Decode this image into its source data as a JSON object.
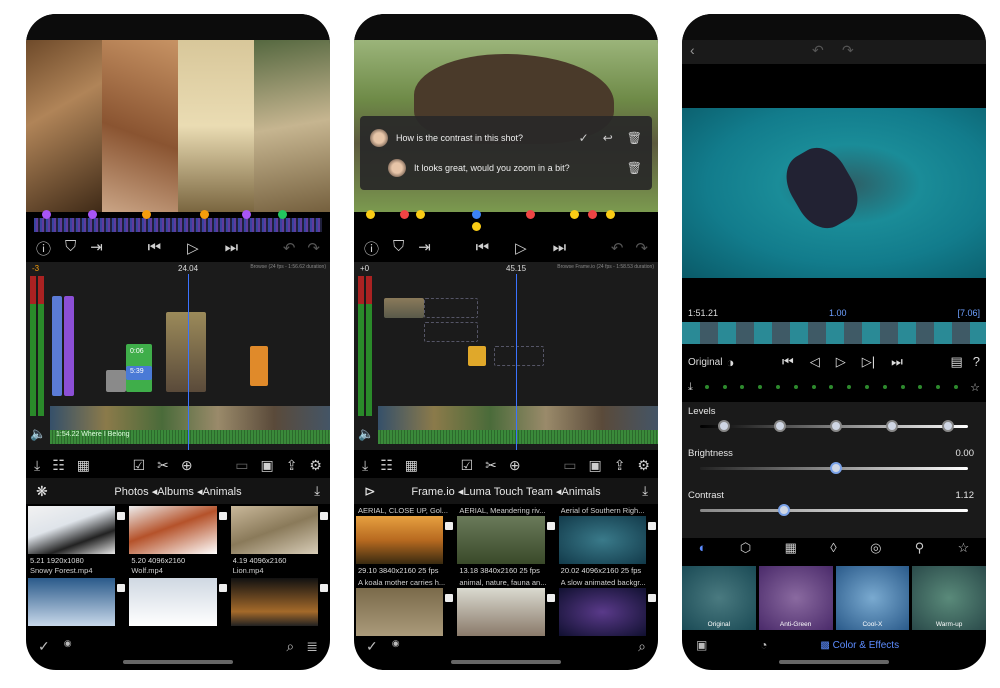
{
  "phone1": {
    "timecode_left": "-3",
    "timecode_center": "24.04",
    "format_label": "Browse (24 fps - 1:56.62 duration)",
    "clip_label_1": "0:06",
    "clip_label_2": "5:39",
    "audio_label": "1:54.22 Where I Belong",
    "library": {
      "breadcrumb": "Photos ◂Albums ◂Animals",
      "tiles": [
        {
          "meta": "5.21  1920x1080",
          "name": "Snowy Forest.mp4"
        },
        {
          "meta": "5.20  4096x2160",
          "name": "Wolf.mp4"
        },
        {
          "meta": "4.19  4096x2160",
          "name": "Lion.mp4"
        }
      ]
    }
  },
  "phone2": {
    "comment_1": "How is the contrast in this shot?",
    "comment_2": "It looks great, would you zoom in a bit?",
    "timecode_left": "+0",
    "timecode_center": "45.15",
    "format_label": "Browse Frame.io (24 fps - 1:58.53 duration)",
    "library": {
      "breadcrumb": "Frame.io ◂Luma Touch Team ◂Animals",
      "tiles": [
        {
          "name": "AERIAL, CLOSE UP,  Gol...",
          "meta": "29.10  3840x2160  25 fps"
        },
        {
          "name": "AERIAL,  Meandering riv...",
          "meta": "13.18  3840x2160  25 fps"
        },
        {
          "name": "Aerial of Southern Righ...",
          "meta": "20.02  4096x2160  25 fps"
        },
        {
          "name": "A koala mother carries h...",
          "meta": ""
        },
        {
          "name": "animal, nature, fauna an...",
          "meta": ""
        },
        {
          "name": "A slow animated backgr...",
          "meta": ""
        }
      ]
    }
  },
  "phone3": {
    "timecode_left": "1:51.21",
    "timecode_center": "1.00",
    "timecode_right": "[7.06]",
    "original_label": "Original",
    "params": [
      {
        "label": "Levels",
        "value": ""
      },
      {
        "label": "Brightness",
        "value": "0.00"
      },
      {
        "label": "Contrast",
        "value": "1.12"
      }
    ],
    "presets": [
      "Original",
      "Anti-Green",
      "Cool-X",
      "Warm-up"
    ],
    "bottom_label": "Color & Effects"
  }
}
